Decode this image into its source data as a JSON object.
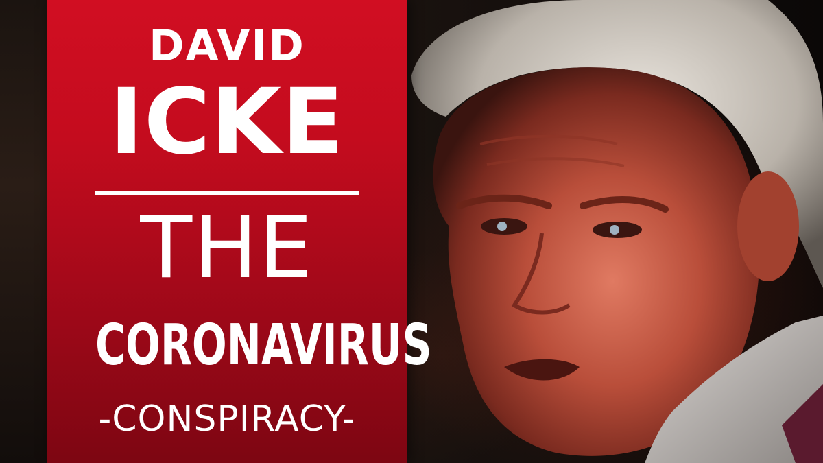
{
  "thumbnail": {
    "line1": "DAVID",
    "line2": "ICKE",
    "line3": "THE",
    "line4": "CORONAVIRUS",
    "line5": "-CONSPIRACY-"
  },
  "colors": {
    "panel_top": "#d10e22",
    "panel_bottom": "#7d0612",
    "text": "#ffffff"
  },
  "image": {
    "subject": "portrait-photo"
  }
}
